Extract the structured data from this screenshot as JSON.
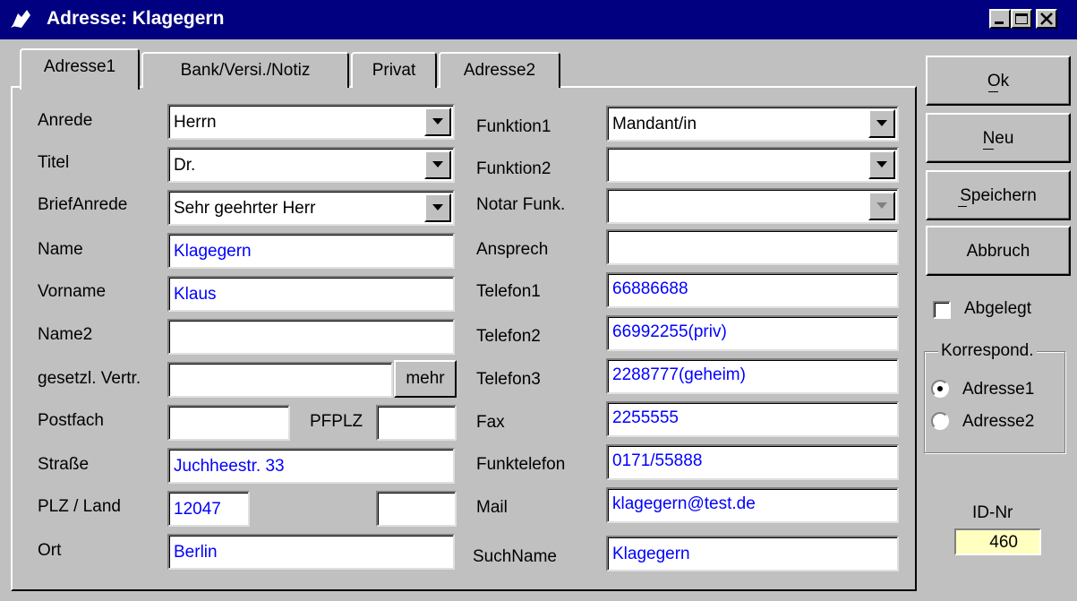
{
  "window": {
    "title": "Adresse: Klagegern",
    "minimize_icon": "minimize-icon",
    "maximize_icon": "maximize-icon",
    "close_icon": "close-icon"
  },
  "tabs": [
    {
      "label": "Adresse1",
      "active": true
    },
    {
      "label": "Bank/Versi./Notiz",
      "active": false
    },
    {
      "label": "Privat",
      "active": false
    },
    {
      "label": "Adresse2",
      "active": false
    }
  ],
  "left": {
    "anrede": {
      "label": "Anrede",
      "value": "Herrn"
    },
    "titel": {
      "label": "Titel",
      "value": "Dr."
    },
    "briefanrede": {
      "label": "BriefAnrede",
      "value": "Sehr geehrter Herr"
    },
    "name": {
      "label": "Name",
      "value": "Klagegern"
    },
    "vorname": {
      "label": "Vorname",
      "value": "Klaus"
    },
    "name2": {
      "label": "Name2",
      "value": ""
    },
    "vertr": {
      "label": "gesetzl. Vertr.",
      "value": "",
      "button": "mehr"
    },
    "postfach": {
      "label": "Postfach",
      "value": "",
      "pfplz_label": "PFPLZ",
      "pfplz_value": ""
    },
    "strasse": {
      "label": "Straße",
      "value": "Juchheestr. 33"
    },
    "plz": {
      "label": "PLZ / Land",
      "value": "12047",
      "land": ""
    },
    "ort": {
      "label": "Ort",
      "value": "Berlin"
    }
  },
  "right": {
    "funktion1": {
      "label": "Funktion1",
      "value": "Mandant/in"
    },
    "funktion2": {
      "label": "Funktion2",
      "value": ""
    },
    "notar": {
      "label": "Notar Funk.",
      "value": ""
    },
    "ansprech": {
      "label": "Ansprech",
      "value": ""
    },
    "telefon1": {
      "label": "Telefon1",
      "value": "66886688"
    },
    "telefon2": {
      "label": "Telefon2",
      "value": "66992255(priv)"
    },
    "telefon3": {
      "label": "Telefon3",
      "value": "2288777(geheim)"
    },
    "fax": {
      "label": "Fax",
      "value": "2255555"
    },
    "funktelefon": {
      "label": "Funktelefon",
      "value": "0171/55888"
    },
    "mail": {
      "label": "Mail",
      "value": "klagegern@test.de"
    },
    "suchname": {
      "label": "SuchName",
      "value": "Klagegern"
    }
  },
  "buttons": {
    "ok": "Ok",
    "neu": "Neu",
    "speichern": "Speichern",
    "abbruch": "Abbruch"
  },
  "abgelegt": {
    "label": "Abgelegt",
    "checked": false
  },
  "korrespond": {
    "legend": "Korrespond.",
    "options": [
      {
        "label": "Adresse1",
        "selected": true
      },
      {
        "label": "Adresse2",
        "selected": false
      }
    ]
  },
  "id": {
    "label": "ID-Nr",
    "value": "460"
  }
}
